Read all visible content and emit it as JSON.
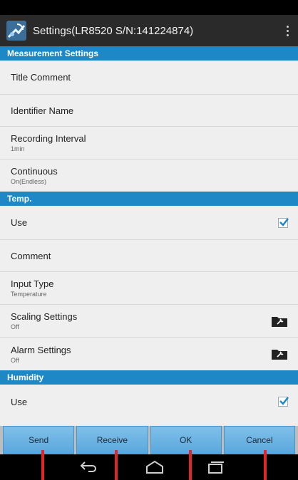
{
  "app": {
    "title": "Settings(LR8520 S/N:141224874)"
  },
  "sections": {
    "measurement": {
      "header": "Measurement Settings",
      "title_comment": "Title Comment",
      "identifier_name": "Identifier Name",
      "recording_interval": {
        "label": "Recording Interval",
        "value": "1min"
      },
      "continuous": {
        "label": "Continuous",
        "value": "On(Endless)"
      }
    },
    "temp": {
      "header": "Temp.",
      "use": {
        "label": "Use",
        "checked": true
      },
      "comment": "Comment",
      "input_type": {
        "label": "Input Type",
        "value": "Temperature"
      },
      "scaling": {
        "label": "Scaling Settings",
        "value": "Off"
      },
      "alarm": {
        "label": "Alarm Settings",
        "value": "Off"
      }
    },
    "humidity": {
      "header": "Humidity",
      "use": {
        "label": "Use",
        "checked": true
      }
    }
  },
  "buttons": {
    "send": "Send",
    "receive": "Receive",
    "ok": "OK",
    "cancel": "Cancel"
  },
  "colors": {
    "section_header": "#1e88c7",
    "button": "#6fb6e5",
    "marker": "#e2242b",
    "checkmark": "#1e88c7"
  },
  "icons": [
    "app-logo-icon",
    "overflow-menu-icon",
    "checkbox-checked-icon",
    "folder-settings-icon",
    "back-icon",
    "home-icon",
    "recents-icon"
  ]
}
